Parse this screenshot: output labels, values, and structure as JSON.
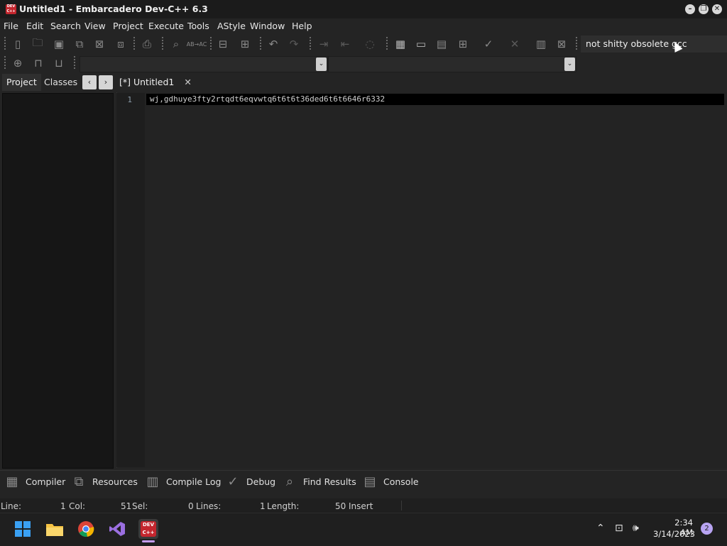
{
  "window": {
    "title": "Untitled1 - Embarcadero Dev-C++ 6.3",
    "icon": "devcpp-app-icon",
    "icon_text": "DEV C++",
    "controls": [
      "minimize-icon",
      "restore-icon",
      "close-icon"
    ]
  },
  "menu": [
    "File",
    "Edit",
    "Search",
    "View",
    "Project",
    "Execute",
    "Tools",
    "AStyle",
    "Window",
    "Help"
  ],
  "toolbar": {
    "compiler_selection": "not shitty obsolete gcc"
  },
  "side_panel": {
    "tabs": [
      "Project",
      "Classes"
    ],
    "prev_label": "‹",
    "next_label": "›"
  },
  "editor": {
    "tab_label": "[*] Untitled1",
    "lines": [
      {
        "number": "1",
        "text": "wj,gdhuye3fty2rtqdt6eqvwtq6t6t6t36ded6t6t6646r6332"
      }
    ]
  },
  "bottom_tabs": [
    "Compiler",
    "Resources",
    "Compile Log",
    "Debug",
    "Find Results",
    "Console"
  ],
  "status_bar": {
    "line_label": "Line:",
    "line_value": "1",
    "col_label": "Col:",
    "col_value": "51",
    "sel_label": "Sel:",
    "sel_value": "0",
    "lines_label": "Lines:",
    "lines_value": "1",
    "length_label": "Length:",
    "length_value": "50",
    "mode": "Insert"
  },
  "taskbar": {
    "apps": [
      "windows-start-icon",
      "file-explorer-icon",
      "chrome-icon",
      "visual-studio-icon",
      "devcpp-icon"
    ],
    "devcpp_icon_text": "DEV C++",
    "time": "2:34 AM",
    "date": "3/14/2023",
    "notification_count": "2"
  },
  "colors": {
    "background": "#242424",
    "editor": "#232323",
    "current_line": "#000000",
    "app_icon": "#c4262e",
    "notification_badge": "#b8a4f2"
  }
}
